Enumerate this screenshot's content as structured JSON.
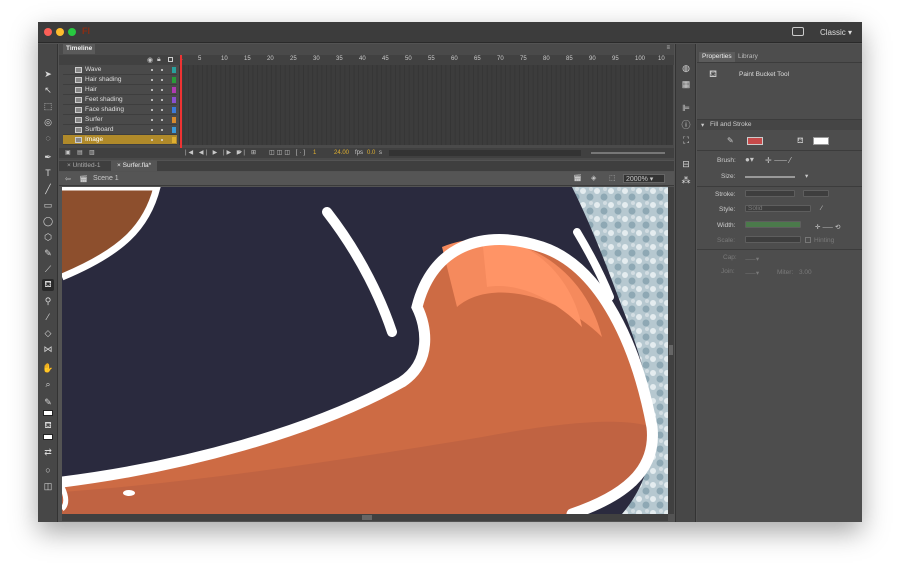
{
  "app": {
    "logo": "Fl",
    "workspace": "Classic"
  },
  "timeline": {
    "tab": "Timeline",
    "ruler": [
      "1",
      "5",
      "10",
      "15",
      "20",
      "25",
      "30",
      "35",
      "40",
      "45",
      "50",
      "55",
      "60",
      "65",
      "70",
      "75",
      "80",
      "85",
      "90",
      "95",
      "100",
      "10"
    ],
    "layers": [
      {
        "name": "Wave",
        "color": "#29a19c"
      },
      {
        "name": "Hair shading",
        "color": "#2a9d3a"
      },
      {
        "name": "Hair",
        "color": "#b03ab0"
      },
      {
        "name": "Feet shading",
        "color": "#8a4fd0"
      },
      {
        "name": "Face shading",
        "color": "#3b7ad9"
      },
      {
        "name": "Surfer",
        "color": "#d98a2b"
      },
      {
        "name": "Surfboard",
        "color": "#3b9ad9"
      },
      {
        "name": "Image",
        "color": "#e0b030"
      }
    ],
    "current_frame": "1",
    "fps": "24.00",
    "fps_unit": "fps",
    "time": "0.0",
    "time_unit": "s"
  },
  "documents": {
    "tabs": [
      "Untitled-1",
      "Surfer.fla*"
    ]
  },
  "scene": {
    "name": "Scene 1",
    "zoom": "2000%"
  },
  "properties": {
    "tabs": [
      "Properties",
      "Library"
    ],
    "tool_name": "Paint Bucket Tool",
    "section": "Fill and Stroke",
    "brush_label": "Brush:",
    "size_label": "Size:",
    "stroke_label": "Stroke:",
    "style_label": "Style:",
    "style_value": "Solid",
    "width_label": "Width:",
    "scale_label": "Scale:",
    "hinting_label": "Hinting",
    "cap_label": "Cap:",
    "join_label": "Join:",
    "miter_label": "Miter:",
    "miter_value": "3.00"
  },
  "colors": {
    "stroke": "#c64a4a",
    "fill": "#ffffff",
    "accent": "#e0b030",
    "skin": "#e67a4c",
    "dark": "#2a2a3e"
  }
}
